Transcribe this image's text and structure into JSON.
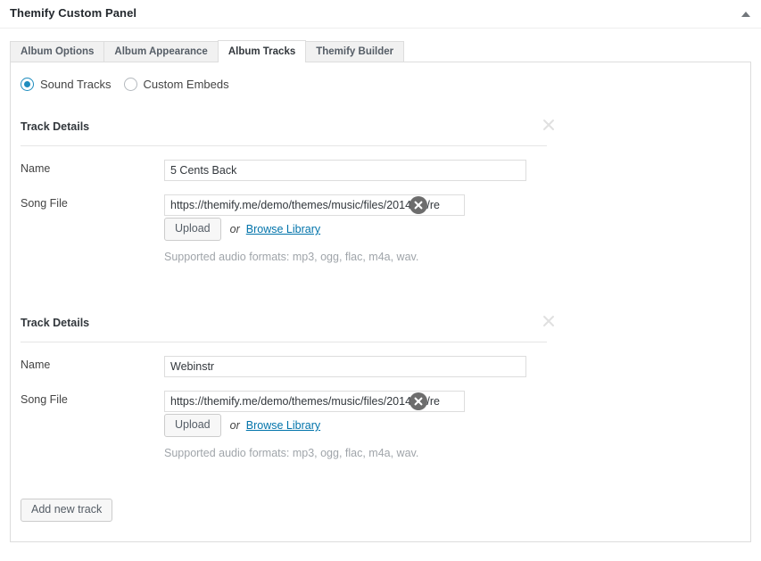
{
  "panel": {
    "title": "Themify Custom Panel",
    "collapse_icon": "triangle-up-icon"
  },
  "tabs": [
    {
      "label": "Album Options",
      "active": false
    },
    {
      "label": "Album Appearance",
      "active": false
    },
    {
      "label": "Album Tracks",
      "active": true
    },
    {
      "label": "Themify Builder",
      "active": false
    }
  ],
  "source_mode": {
    "options": [
      {
        "label": "Sound Tracks",
        "selected": true
      },
      {
        "label": "Custom Embeds",
        "selected": false
      }
    ]
  },
  "labels": {
    "track_details": "Track Details",
    "name": "Name",
    "song_file": "Song File",
    "upload": "Upload",
    "or": "or",
    "browse_library": "Browse Library",
    "supported_formats": "Supported audio formats: mp3, ogg, flac, m4a, wav.",
    "add_new_track": "Add new track",
    "close_icon": "close-x-icon",
    "remove_icon": "remove-circle-icon"
  },
  "tracks": [
    {
      "heading": "Track Details",
      "name_value": "5 Cents Back",
      "name_placeholder": "",
      "song_file_value": "https://themify.me/demo/themes/music/files/2014/06/re",
      "song_file_placeholder": ""
    },
    {
      "heading": "Track Details",
      "name_value": "Webinstr",
      "name_placeholder": "",
      "song_file_value": "https://themify.me/demo/themes/music/files/2014/06/re",
      "song_file_placeholder": ""
    }
  ],
  "colors": {
    "accent": "#1e8cbe",
    "link": "#0073aa",
    "border": "#dddddd",
    "tab_inactive_bg": "#f1f1f1",
    "help_text": "#a0a5aa",
    "remove_circle": "#6d6d6d"
  }
}
